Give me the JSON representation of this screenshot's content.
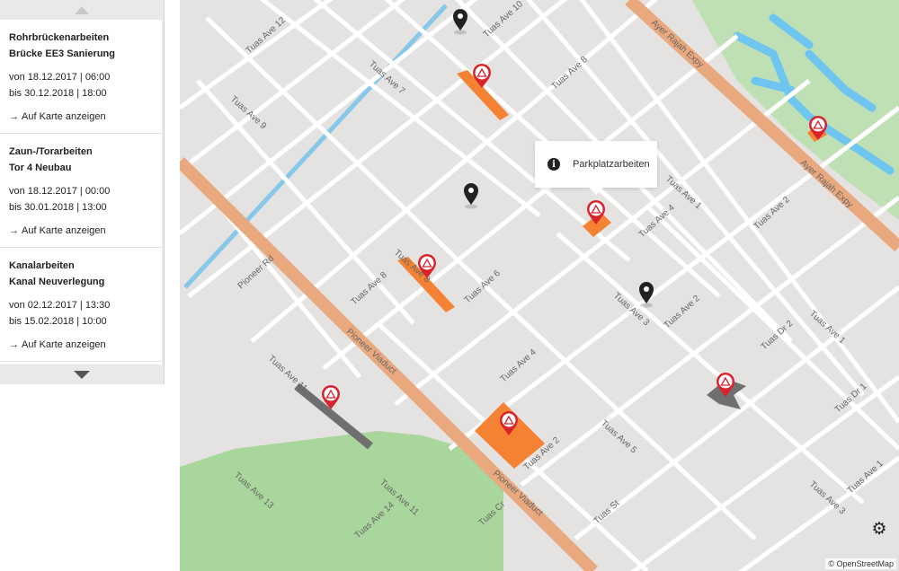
{
  "sidebar": {
    "items": [
      {
        "line1": "Rohrbrückenarbeiten",
        "line2": "Brücke EE3 Sanierung",
        "from": "von 18.12.2017 | 06:00",
        "to": "bis 30.12.2018 | 18:00",
        "link": "Auf Karte anzeigen"
      },
      {
        "line1": "Zaun-/Torarbeiten",
        "line2": "Tor 4 Neubau",
        "from": "von 18.12.2017 | 00:00",
        "to": "bis 30.01.2018 | 13:00",
        "link": "Auf Karte anzeigen"
      },
      {
        "line1": "Kanalarbeiten",
        "line2": "Kanal Neuverlegung",
        "from": "von 02.12.2017 | 13:30",
        "to": "bis 15.02.2018 | 10:00",
        "link": "Auf Karte anzeigen"
      }
    ]
  },
  "map": {
    "popup": {
      "text": "Parkplatzarbeiten",
      "icon": "info-icon"
    },
    "attribution": "© OpenStreetMap",
    "settings_icon": "gear-icon",
    "labels": {
      "pioneer_rd": "Pioneer Rd",
      "pioneer_viaduct_1": "Pioneer Viaduct",
      "pioneer_viaduct_2": "Pioneer Viaduct",
      "ayer_1": "Ayer Rajah Expy",
      "ayer_2": "Ayer Rajah Expy",
      "tuas_ave_12": "Tuas Ave 12",
      "tuas_ave_10": "Tuas Ave 10",
      "tuas_ave_9": "Tuas Ave 9",
      "tuas_ave_7": "Tuas Ave 7",
      "tuas_ave_8_a": "Tuas Ave 8",
      "tuas_ave_8_b": "Tuas Ave 8",
      "tuas_ave_8_c": "Tuas Ave 8",
      "tuas_ave_6": "Tuas Ave 6",
      "tuas_ave_4_a": "Tuas Ave 4",
      "tuas_ave_4_b": "Tuas Ave 4",
      "tuas_ave_3_a": "Tuas Ave 3",
      "tuas_ave_3_b": "Tuas Ave 3",
      "tuas_ave_2_a": "Tuas Ave 2",
      "tuas_ave_2_b": "Tuas Ave 2",
      "tuas_ave_2_c": "Tuas Ave 2",
      "tuas_ave_1_a": "Tuas Ave 1",
      "tuas_ave_1_b": "Tuas Ave 1",
      "tuas_ave_1_c": "Tuas Ave 1",
      "tuas_ave_5": "Tuas Ave 5",
      "tuas_ave_11_a": "Tuas Ave 11",
      "tuas_ave_11_b": "Tuas Ave 11",
      "tuas_ave_13": "Tuas Ave 13",
      "tuas_ave_14": "Tuas Ave 14",
      "tuas_dr_1": "Tuas Dr 1",
      "tuas_dr_2": "Tuas Dr 2",
      "tuas_st": "Tuas St",
      "tuas_cr": "Tuas Cr"
    }
  },
  "colors": {
    "work_zone": "#f58232",
    "closed_zone": "#6f6f6f",
    "marker_red": "#d9232a",
    "marker_dark": "#222222",
    "road": "#ffffff",
    "expressway": "#e9a87d",
    "water": "#6ec6f0",
    "park": "#a6d69a"
  }
}
